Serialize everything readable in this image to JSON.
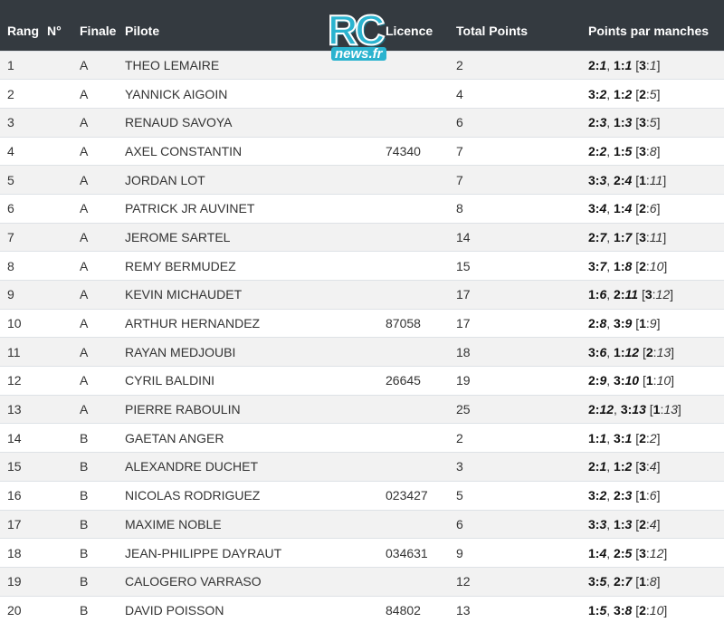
{
  "header": {
    "rang": "Rang",
    "num": "N°",
    "finale": "Finale",
    "pilote": "Pilote",
    "licence": "Licence",
    "total": "Total Points",
    "points": "Points par manches"
  },
  "logo": {
    "main": "RC",
    "sub": "news.fr"
  },
  "rows": [
    {
      "rang": "1",
      "finale": "A",
      "pilote": "THEO LEMAIRE",
      "licence": "",
      "total": "2",
      "pts": [
        [
          "2",
          "1",
          "b"
        ],
        [
          "1",
          "1",
          "b"
        ],
        [
          "3",
          "1",
          "i"
        ]
      ]
    },
    {
      "rang": "2",
      "finale": "A",
      "pilote": "YANNICK AIGOIN",
      "licence": "",
      "total": "4",
      "pts": [
        [
          "3",
          "2",
          "b"
        ],
        [
          "1",
          "2",
          "b"
        ],
        [
          "2",
          "5",
          "i"
        ]
      ]
    },
    {
      "rang": "3",
      "finale": "A",
      "pilote": "RENAUD SAVOYA",
      "licence": "",
      "total": "6",
      "pts": [
        [
          "2",
          "3",
          "b"
        ],
        [
          "1",
          "3",
          "b"
        ],
        [
          "3",
          "5",
          "i"
        ]
      ]
    },
    {
      "rang": "4",
      "finale": "A",
      "pilote": "AXEL CONSTANTIN",
      "licence": "74340",
      "total": "7",
      "pts": [
        [
          "2",
          "2",
          "b"
        ],
        [
          "1",
          "5",
          "b"
        ],
        [
          "3",
          "8",
          "i"
        ]
      ]
    },
    {
      "rang": "5",
      "finale": "A",
      "pilote": "JORDAN LOT",
      "licence": "",
      "total": "7",
      "pts": [
        [
          "3",
          "3",
          "b"
        ],
        [
          "2",
          "4",
          "b"
        ],
        [
          "1",
          "11",
          "i"
        ]
      ]
    },
    {
      "rang": "6",
      "finale": "A",
      "pilote": "PATRICK JR AUVINET",
      "licence": "",
      "total": "8",
      "pts": [
        [
          "3",
          "4",
          "b"
        ],
        [
          "1",
          "4",
          "b"
        ],
        [
          "2",
          "6",
          "i"
        ]
      ]
    },
    {
      "rang": "7",
      "finale": "A",
      "pilote": "JEROME SARTEL",
      "licence": "",
      "total": "14",
      "pts": [
        [
          "2",
          "7",
          "b"
        ],
        [
          "1",
          "7",
          "b"
        ],
        [
          "3",
          "11",
          "i"
        ]
      ]
    },
    {
      "rang": "8",
      "finale": "A",
      "pilote": "REMY BERMUDEZ",
      "licence": "",
      "total": "15",
      "pts": [
        [
          "3",
          "7",
          "b"
        ],
        [
          "1",
          "8",
          "b"
        ],
        [
          "2",
          "10",
          "i"
        ]
      ]
    },
    {
      "rang": "9",
      "finale": "A",
      "pilote": "KEVIN MICHAUDET",
      "licence": "",
      "total": "17",
      "pts": [
        [
          "1",
          "6",
          "b"
        ],
        [
          "2",
          "11",
          "b"
        ],
        [
          "3",
          "12",
          "i"
        ]
      ]
    },
    {
      "rang": "10",
      "finale": "A",
      "pilote": "ARTHUR HERNANDEZ",
      "licence": "87058",
      "total": "17",
      "pts": [
        [
          "2",
          "8",
          "b"
        ],
        [
          "3",
          "9",
          "b"
        ],
        [
          "1",
          "9",
          "i"
        ]
      ]
    },
    {
      "rang": "11",
      "finale": "A",
      "pilote": "RAYAN MEDJOUBI",
      "licence": "",
      "total": "18",
      "pts": [
        [
          "3",
          "6",
          "b"
        ],
        [
          "1",
          "12",
          "b"
        ],
        [
          "2",
          "13",
          "i"
        ]
      ]
    },
    {
      "rang": "12",
      "finale": "A",
      "pilote": "CYRIL BALDINI",
      "licence": "26645",
      "total": "19",
      "pts": [
        [
          "2",
          "9",
          "b"
        ],
        [
          "3",
          "10",
          "b"
        ],
        [
          "1",
          "10",
          "i"
        ]
      ]
    },
    {
      "rang": "13",
      "finale": "A",
      "pilote": "PIERRE RABOULIN",
      "licence": "",
      "total": "25",
      "pts": [
        [
          "2",
          "12",
          "b"
        ],
        [
          "3",
          "13",
          "b"
        ],
        [
          "1",
          "13",
          "i"
        ]
      ]
    },
    {
      "rang": "14",
      "finale": "B",
      "pilote": "GAETAN ANGER",
      "licence": "",
      "total": "2",
      "pts": [
        [
          "1",
          "1",
          "b"
        ],
        [
          "3",
          "1",
          "b"
        ],
        [
          "2",
          "2",
          "i"
        ]
      ]
    },
    {
      "rang": "15",
      "finale": "B",
      "pilote": "ALEXANDRE DUCHET",
      "licence": "",
      "total": "3",
      "pts": [
        [
          "2",
          "1",
          "b"
        ],
        [
          "1",
          "2",
          "b"
        ],
        [
          "3",
          "4",
          "i"
        ]
      ]
    },
    {
      "rang": "16",
      "finale": "B",
      "pilote": "NICOLAS RODRIGUEZ",
      "licence": "023427",
      "total": "5",
      "pts": [
        [
          "3",
          "2",
          "b"
        ],
        [
          "2",
          "3",
          "b"
        ],
        [
          "1",
          "6",
          "i"
        ]
      ]
    },
    {
      "rang": "17",
      "finale": "B",
      "pilote": "MAXIME NOBLE",
      "licence": "",
      "total": "6",
      "pts": [
        [
          "3",
          "3",
          "b"
        ],
        [
          "1",
          "3",
          "b"
        ],
        [
          "2",
          "4",
          "i"
        ]
      ]
    },
    {
      "rang": "18",
      "finale": "B",
      "pilote": "JEAN-PHILIPPE DAYRAUT",
      "licence": "034631",
      "total": "9",
      "pts": [
        [
          "1",
          "4",
          "b"
        ],
        [
          "2",
          "5",
          "b"
        ],
        [
          "3",
          "12",
          "i"
        ]
      ]
    },
    {
      "rang": "19",
      "finale": "B",
      "pilote": "CALOGERO VARRASO",
      "licence": "",
      "total": "12",
      "pts": [
        [
          "3",
          "5",
          "b"
        ],
        [
          "2",
          "7",
          "b"
        ],
        [
          "1",
          "8",
          "i"
        ]
      ]
    },
    {
      "rang": "20",
      "finale": "B",
      "pilote": "DAVID POISSON",
      "licence": "84802",
      "total": "13",
      "pts": [
        [
          "1",
          "5",
          "b"
        ],
        [
          "3",
          "8",
          "b"
        ],
        [
          "2",
          "10",
          "i"
        ]
      ]
    }
  ]
}
